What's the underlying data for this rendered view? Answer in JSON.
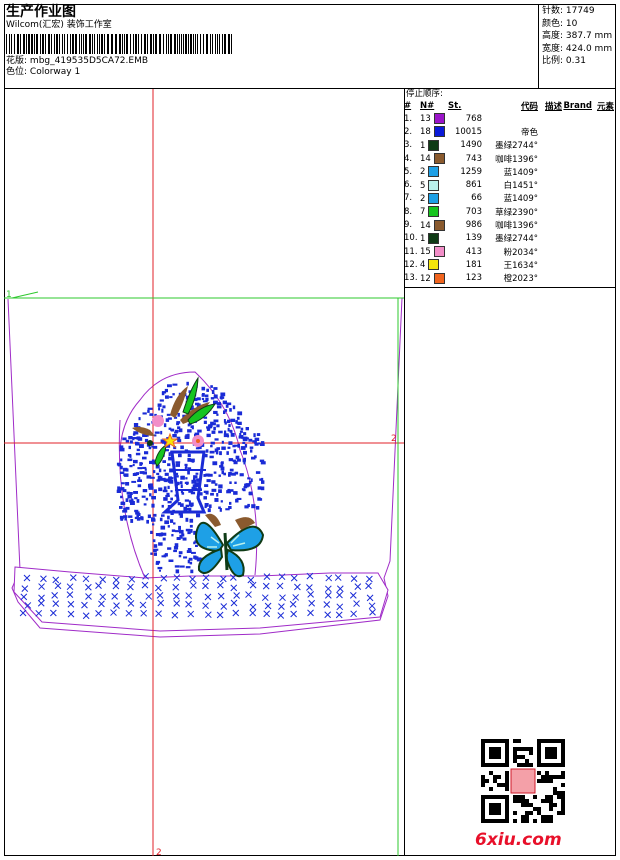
{
  "header": {
    "title": "生产作业图",
    "company": "Wilcom(汇宏) 装饰工作室",
    "design_file_label": "花版:",
    "design_file": "mbg_419535D5CA72.EMB",
    "colorway_label": "色位:",
    "colorway": "Colorway 1"
  },
  "stats": [
    {
      "label": "针数:",
      "value": "17749"
    },
    {
      "label": "颜色:",
      "value": "10"
    },
    {
      "label": "高度:",
      "value": "387.7 mm"
    },
    {
      "label": "宽度:",
      "value": "424.0 mm"
    },
    {
      "label": "比例:",
      "value": "0.31"
    }
  ],
  "legend": {
    "heading": "停止顺序:",
    "columns": [
      "#",
      "N#",
      "St.",
      "代码",
      "描述",
      "Brand",
      "元素"
    ],
    "rows": [
      {
        "n": "1.",
        "needle": "13",
        "color": "#9b15c9",
        "st": "768",
        "code": ""
      },
      {
        "n": "2.",
        "needle": "18",
        "color": "#0a1ad8",
        "st": "10015",
        "code": "帝色"
      },
      {
        "n": "3.",
        "needle": "1",
        "color": "#0f3b16",
        "st": "1490",
        "code": "墨绿2744°"
      },
      {
        "n": "4.",
        "needle": "14",
        "color": "#8a5a2e",
        "st": "743",
        "code": "咖啡1396°"
      },
      {
        "n": "5.",
        "needle": "2",
        "color": "#1ea0e6",
        "st": "1259",
        "code": "蓝1409°"
      },
      {
        "n": "6.",
        "needle": "5",
        "color": "#b9f0ec",
        "st": "861",
        "code": "白1451°"
      },
      {
        "n": "7.",
        "needle": "2",
        "color": "#1ea0e6",
        "st": "66",
        "code": "蓝1409°"
      },
      {
        "n": "8.",
        "needle": "7",
        "color": "#17c51f",
        "st": "703",
        "code": "草绿2390°"
      },
      {
        "n": "9.",
        "needle": "14",
        "color": "#8a5a2e",
        "st": "986",
        "code": "咖啡1396°"
      },
      {
        "n": "10.",
        "needle": "1",
        "color": "#0f3b16",
        "st": "139",
        "code": "墨绿2744°"
      },
      {
        "n": "11.",
        "needle": "15",
        "color": "#f28ec8",
        "st": "413",
        "code": "粉2034°"
      },
      {
        "n": "12.",
        "needle": "4",
        "color": "#f5e60c",
        "st": "181",
        "code": "王1634°"
      },
      {
        "n": "13.",
        "needle": "12",
        "color": "#f0641e",
        "st": "123",
        "code": "橙2023°"
      }
    ]
  },
  "axis_labels": {
    "x_marker": "2",
    "y_marker": "2",
    "green_marker": "1"
  },
  "watermark": "6xiu.com"
}
